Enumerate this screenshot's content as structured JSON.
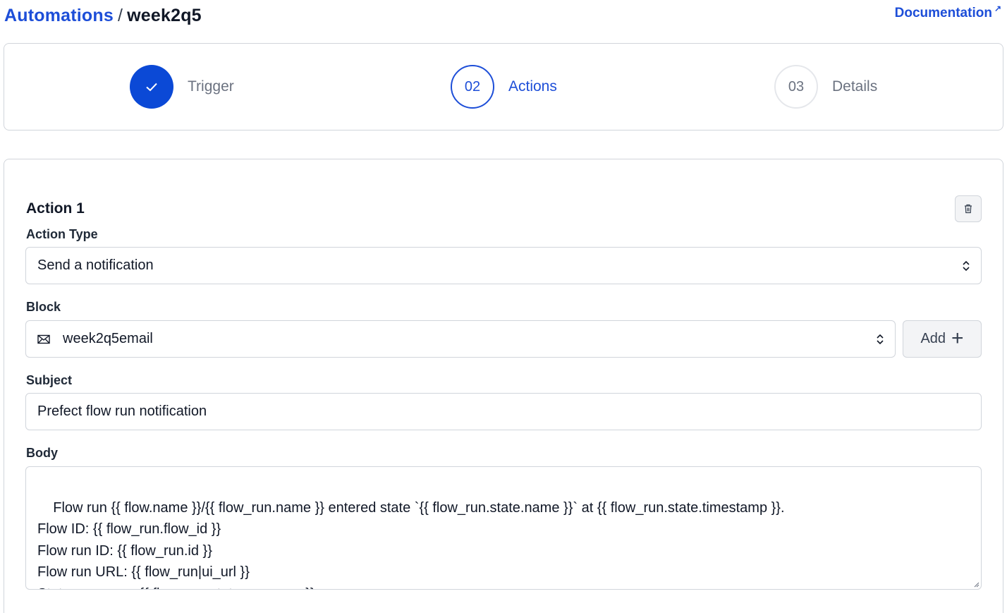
{
  "breadcrumb": {
    "parent": "Automations",
    "separator": "/",
    "current": "week2q5"
  },
  "documentation": {
    "label": "Documentation",
    "icon": "external-link-icon"
  },
  "steps": [
    {
      "number": "✓",
      "label": "Trigger",
      "status": "done"
    },
    {
      "number": "02",
      "label": "Actions",
      "status": "active"
    },
    {
      "number": "03",
      "label": "Details",
      "status": "todo"
    }
  ],
  "action": {
    "title": "Action 1",
    "delete_icon": "trash-icon",
    "action_type": {
      "label": "Action Type",
      "value": "Send a notification"
    },
    "block": {
      "label": "Block",
      "icon": "mail-icon",
      "value": "week2q5email",
      "add_label": "Add",
      "add_icon": "plus-icon"
    },
    "subject": {
      "label": "Subject",
      "value": "Prefect flow run notification"
    },
    "body": {
      "label": "Body",
      "value": "Flow run {{ flow.name }}/{{ flow_run.name }} entered state `{{ flow_run.state.name }}` at {{ flow_run.state.timestamp }}.\nFlow ID: {{ flow_run.flow_id }}\nFlow run ID: {{ flow_run.id }}\nFlow run URL: {{ flow_run|ui_url }}\nState message: {{ flow_run.state.message }}"
    }
  },
  "colors": {
    "accent": "#1d4ed8",
    "step_done": "#0b49d6",
    "border": "#d1d5db"
  }
}
